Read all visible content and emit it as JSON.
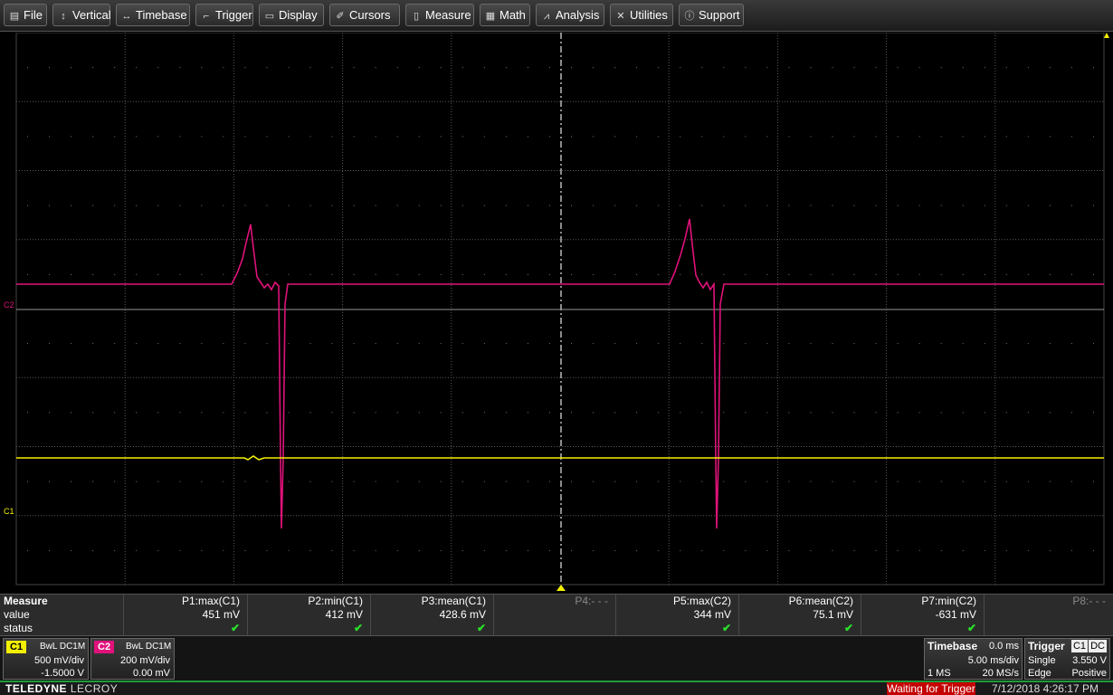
{
  "menu": [
    {
      "label": "File",
      "icon": "folder-icon",
      "glyph": "▤"
    },
    {
      "label": "Vertical",
      "icon": "vertical-arrows-icon",
      "glyph": "↕"
    },
    {
      "label": "Timebase",
      "icon": "horizontal-arrows-icon",
      "glyph": "↔"
    },
    {
      "label": "Trigger",
      "icon": "trigger-edge-icon",
      "glyph": "⌐"
    },
    {
      "label": "Display",
      "icon": "display-icon",
      "glyph": "▭"
    },
    {
      "label": "Cursors",
      "icon": "cursor-icon",
      "glyph": "✐"
    },
    {
      "label": "Measure",
      "icon": "measure-icon",
      "glyph": "▯"
    },
    {
      "label": "Math",
      "icon": "calculator-icon",
      "glyph": "▦"
    },
    {
      "label": "Analysis",
      "icon": "chart-icon",
      "glyph": "⩘"
    },
    {
      "label": "Utilities",
      "icon": "tools-icon",
      "glyph": "✕"
    },
    {
      "label": "Support",
      "icon": "info-icon",
      "glyph": "ⓘ"
    }
  ],
  "colors": {
    "c1": "#f3f000",
    "c2": "#e0127a",
    "grid": "#5a5a5a",
    "trigger_status": "#c40000",
    "status_ok": "#29e029"
  },
  "markers": {
    "c2": "C2",
    "c1": "C1"
  },
  "measure": {
    "title": "Measure",
    "row_value": "value",
    "row_status": "status",
    "params": [
      {
        "name": "P1:max(C1)",
        "value": "451 mV",
        "status": "✔",
        "active": true
      },
      {
        "name": "P2:min(C1)",
        "value": "412 mV",
        "status": "✔",
        "active": true
      },
      {
        "name": "P3:mean(C1)",
        "value": "428.6 mV",
        "status": "✔",
        "active": true
      },
      {
        "name": "P4:- - -",
        "value": "",
        "status": "",
        "active": false
      },
      {
        "name": "P5:max(C2)",
        "value": "344 mV",
        "status": "✔",
        "active": true
      },
      {
        "name": "P6:mean(C2)",
        "value": "75.1 mV",
        "status": "✔",
        "active": true
      },
      {
        "name": "P7:min(C2)",
        "value": "-631 mV",
        "status": "✔",
        "active": true
      },
      {
        "name": "P8:- - -",
        "value": "",
        "status": "",
        "active": false
      }
    ]
  },
  "channels": {
    "c1": {
      "tag": "C1",
      "coupling": "BwL  DC1M",
      "vdiv": "500 mV/div",
      "offset": "-1.5000 V"
    },
    "c2": {
      "tag": "C2",
      "coupling": "BwL  DC1M",
      "vdiv": "200 mV/div",
      "offset": "0.00 mV"
    }
  },
  "timebase": {
    "title": "Timebase",
    "delay": "0.0 ms",
    "tdiv": "5.00 ms/div",
    "points": "1 MS",
    "rate": "20 MS/s"
  },
  "trigger": {
    "title": "Trigger",
    "source": "C1",
    "coupling": "DC",
    "mode": "Single",
    "level": "3.550 V",
    "type": "Edge",
    "slope": "Positive"
  },
  "status": {
    "brand_bold": "TELEDYNE",
    "brand_rest": " LECROY",
    "trigger_state": "Waiting for Trigger",
    "datetime": "7/12/2018 4:26:17 PM"
  }
}
